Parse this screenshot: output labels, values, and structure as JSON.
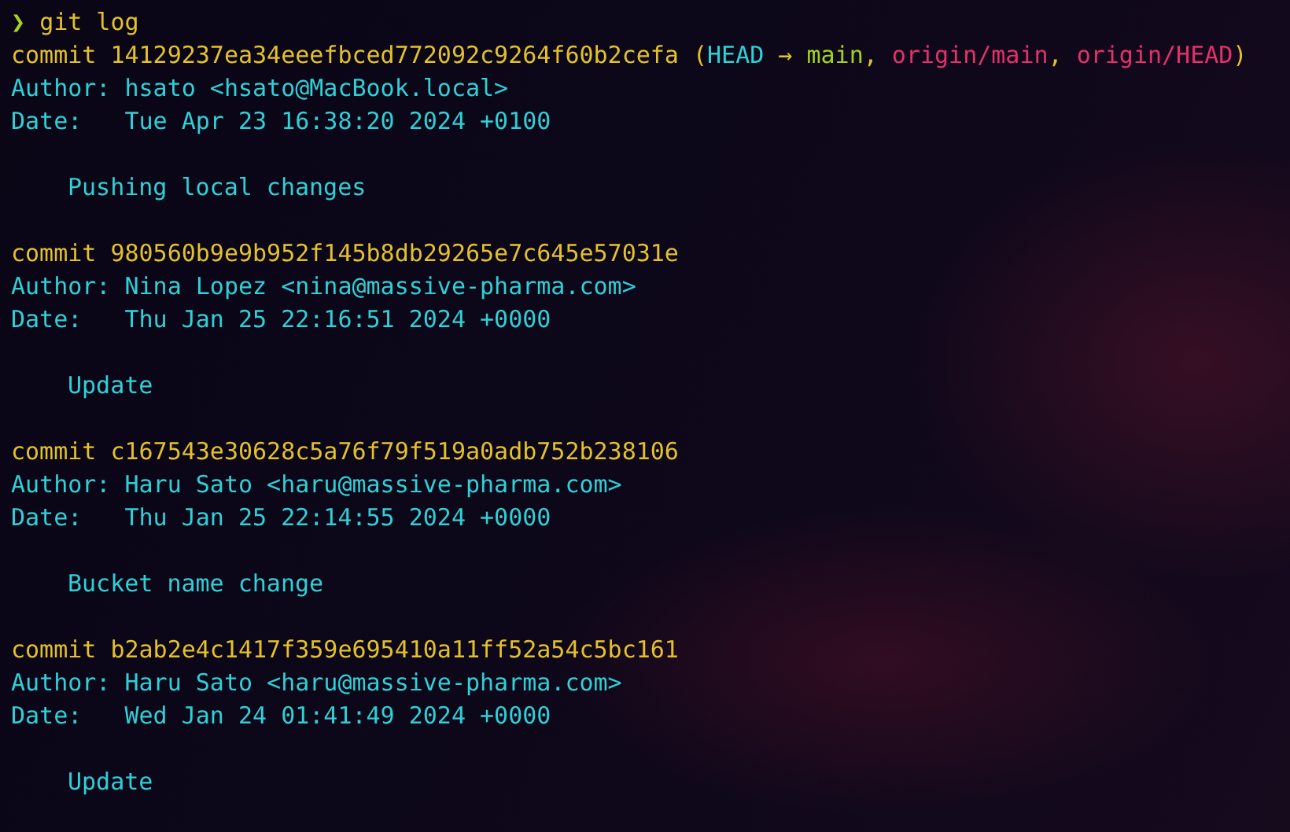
{
  "prompt": {
    "symbol": "❯",
    "command": "git log"
  },
  "commits": [
    {
      "keyword": "commit",
      "hash": "14129237ea34eeefbced772092c9264f60b2cefa",
      "refs": [
        {
          "text": "(",
          "kind": "punct"
        },
        {
          "text": "HEAD",
          "kind": "head"
        },
        {
          "text": " → ",
          "kind": "punct"
        },
        {
          "text": "main",
          "kind": "branch"
        },
        {
          "text": ", ",
          "kind": "punct"
        },
        {
          "text": "origin/main",
          "kind": "remote"
        },
        {
          "text": ", ",
          "kind": "punct"
        },
        {
          "text": "origin/HEAD",
          "kind": "remote"
        },
        {
          "text": ")",
          "kind": "punct"
        }
      ],
      "author": "Author: hsato <hsato@MacBook.local>",
      "date": "Date:   Tue Apr 23 16:38:20 2024 +0100",
      "message": "Pushing local changes"
    },
    {
      "keyword": "commit",
      "hash": "980560b9e9b952f145b8db29265e7c645e57031e",
      "author": "Author: Nina Lopez <nina@massive-pharma.com>",
      "date": "Date:   Thu Jan 25 22:16:51 2024 +0000",
      "message": "Update"
    },
    {
      "keyword": "commit",
      "hash": "c167543e30628c5a76f79f519a0adb752b238106",
      "author": "Author: Haru Sato <haru@massive-pharma.com>",
      "date": "Date:   Thu Jan 25 22:14:55 2024 +0000",
      "message": "Bucket name change"
    },
    {
      "keyword": "commit",
      "hash": "b2ab2e4c1417f359e695410a11ff52a54c5bc161",
      "author": "Author: Haru Sato <haru@massive-pharma.com>",
      "date": "Date:   Wed Jan 24 01:41:49 2024 +0000",
      "message": "Update"
    }
  ]
}
